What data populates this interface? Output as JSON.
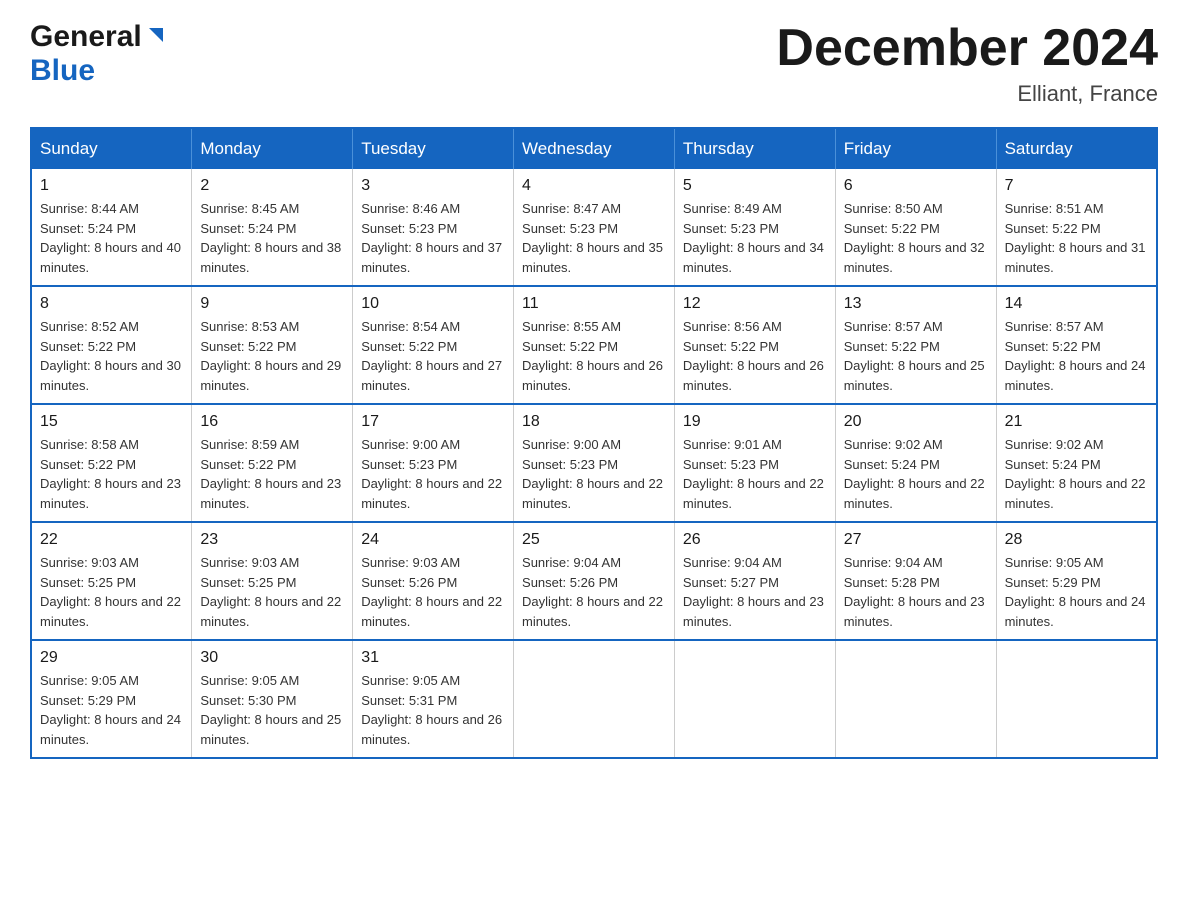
{
  "header": {
    "logo_general": "General",
    "logo_blue": "Blue",
    "month_title": "December 2024",
    "location": "Elliant, France"
  },
  "days_of_week": [
    "Sunday",
    "Monday",
    "Tuesday",
    "Wednesday",
    "Thursday",
    "Friday",
    "Saturday"
  ],
  "weeks": [
    [
      {
        "day": "1",
        "sunrise": "8:44 AM",
        "sunset": "5:24 PM",
        "daylight": "8 hours and 40 minutes."
      },
      {
        "day": "2",
        "sunrise": "8:45 AM",
        "sunset": "5:24 PM",
        "daylight": "8 hours and 38 minutes."
      },
      {
        "day": "3",
        "sunrise": "8:46 AM",
        "sunset": "5:23 PM",
        "daylight": "8 hours and 37 minutes."
      },
      {
        "day": "4",
        "sunrise": "8:47 AM",
        "sunset": "5:23 PM",
        "daylight": "8 hours and 35 minutes."
      },
      {
        "day": "5",
        "sunrise": "8:49 AM",
        "sunset": "5:23 PM",
        "daylight": "8 hours and 34 minutes."
      },
      {
        "day": "6",
        "sunrise": "8:50 AM",
        "sunset": "5:22 PM",
        "daylight": "8 hours and 32 minutes."
      },
      {
        "day": "7",
        "sunrise": "8:51 AM",
        "sunset": "5:22 PM",
        "daylight": "8 hours and 31 minutes."
      }
    ],
    [
      {
        "day": "8",
        "sunrise": "8:52 AM",
        "sunset": "5:22 PM",
        "daylight": "8 hours and 30 minutes."
      },
      {
        "day": "9",
        "sunrise": "8:53 AM",
        "sunset": "5:22 PM",
        "daylight": "8 hours and 29 minutes."
      },
      {
        "day": "10",
        "sunrise": "8:54 AM",
        "sunset": "5:22 PM",
        "daylight": "8 hours and 27 minutes."
      },
      {
        "day": "11",
        "sunrise": "8:55 AM",
        "sunset": "5:22 PM",
        "daylight": "8 hours and 26 minutes."
      },
      {
        "day": "12",
        "sunrise": "8:56 AM",
        "sunset": "5:22 PM",
        "daylight": "8 hours and 26 minutes."
      },
      {
        "day": "13",
        "sunrise": "8:57 AM",
        "sunset": "5:22 PM",
        "daylight": "8 hours and 25 minutes."
      },
      {
        "day": "14",
        "sunrise": "8:57 AM",
        "sunset": "5:22 PM",
        "daylight": "8 hours and 24 minutes."
      }
    ],
    [
      {
        "day": "15",
        "sunrise": "8:58 AM",
        "sunset": "5:22 PM",
        "daylight": "8 hours and 23 minutes."
      },
      {
        "day": "16",
        "sunrise": "8:59 AM",
        "sunset": "5:22 PM",
        "daylight": "8 hours and 23 minutes."
      },
      {
        "day": "17",
        "sunrise": "9:00 AM",
        "sunset": "5:23 PM",
        "daylight": "8 hours and 22 minutes."
      },
      {
        "day": "18",
        "sunrise": "9:00 AM",
        "sunset": "5:23 PM",
        "daylight": "8 hours and 22 minutes."
      },
      {
        "day": "19",
        "sunrise": "9:01 AM",
        "sunset": "5:23 PM",
        "daylight": "8 hours and 22 minutes."
      },
      {
        "day": "20",
        "sunrise": "9:02 AM",
        "sunset": "5:24 PM",
        "daylight": "8 hours and 22 minutes."
      },
      {
        "day": "21",
        "sunrise": "9:02 AM",
        "sunset": "5:24 PM",
        "daylight": "8 hours and 22 minutes."
      }
    ],
    [
      {
        "day": "22",
        "sunrise": "9:03 AM",
        "sunset": "5:25 PM",
        "daylight": "8 hours and 22 minutes."
      },
      {
        "day": "23",
        "sunrise": "9:03 AM",
        "sunset": "5:25 PM",
        "daylight": "8 hours and 22 minutes."
      },
      {
        "day": "24",
        "sunrise": "9:03 AM",
        "sunset": "5:26 PM",
        "daylight": "8 hours and 22 minutes."
      },
      {
        "day": "25",
        "sunrise": "9:04 AM",
        "sunset": "5:26 PM",
        "daylight": "8 hours and 22 minutes."
      },
      {
        "day": "26",
        "sunrise": "9:04 AM",
        "sunset": "5:27 PM",
        "daylight": "8 hours and 23 minutes."
      },
      {
        "day": "27",
        "sunrise": "9:04 AM",
        "sunset": "5:28 PM",
        "daylight": "8 hours and 23 minutes."
      },
      {
        "day": "28",
        "sunrise": "9:05 AM",
        "sunset": "5:29 PM",
        "daylight": "8 hours and 24 minutes."
      }
    ],
    [
      {
        "day": "29",
        "sunrise": "9:05 AM",
        "sunset": "5:29 PM",
        "daylight": "8 hours and 24 minutes."
      },
      {
        "day": "30",
        "sunrise": "9:05 AM",
        "sunset": "5:30 PM",
        "daylight": "8 hours and 25 minutes."
      },
      {
        "day": "31",
        "sunrise": "9:05 AM",
        "sunset": "5:31 PM",
        "daylight": "8 hours and 26 minutes."
      },
      null,
      null,
      null,
      null
    ]
  ],
  "labels": {
    "sunrise": "Sunrise:",
    "sunset": "Sunset:",
    "daylight": "Daylight:"
  }
}
